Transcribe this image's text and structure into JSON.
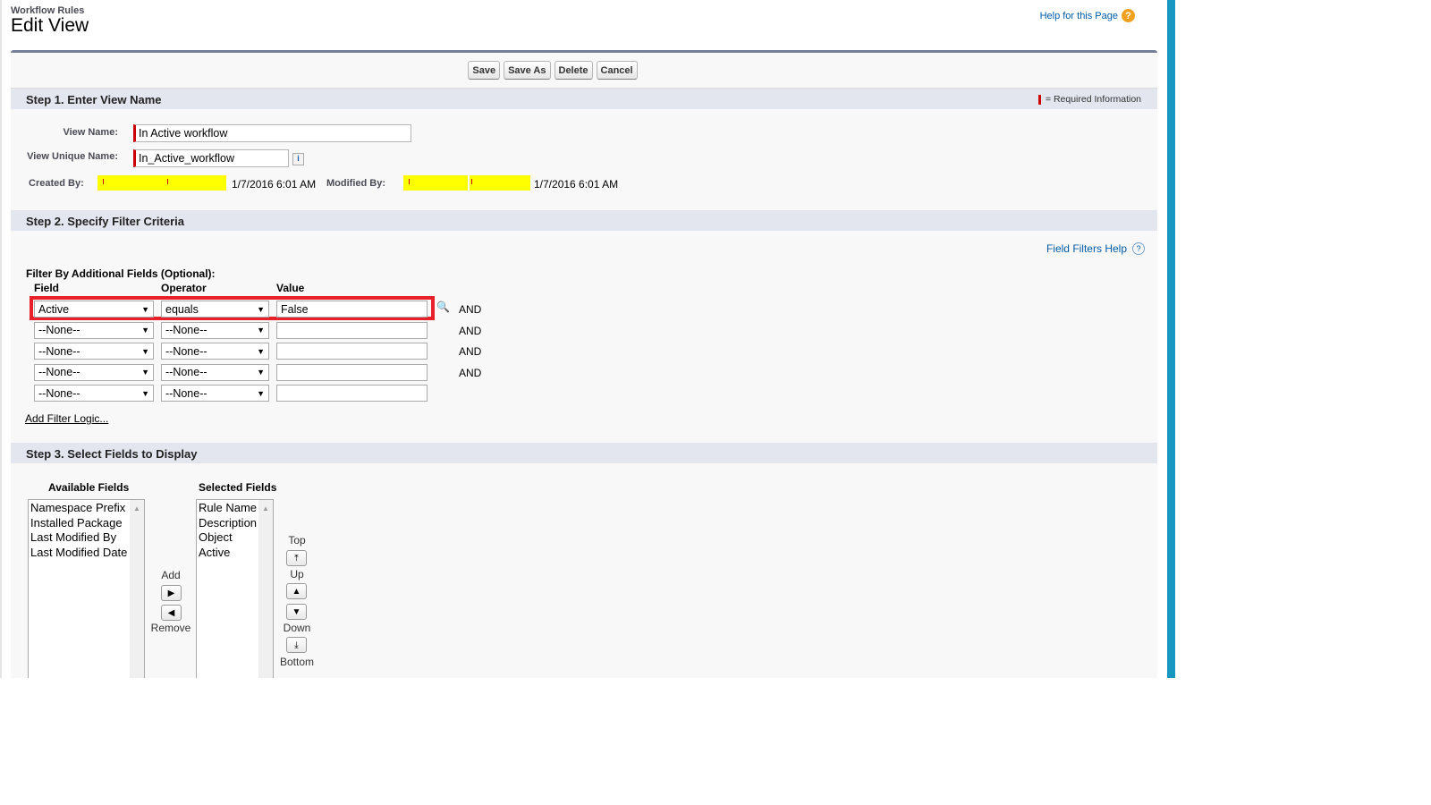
{
  "header": {
    "breadcrumb": "Workflow Rules",
    "title": "Edit View",
    "help_link": "Help for this Page"
  },
  "toolbar": {
    "save": "Save",
    "save_as": "Save As",
    "delete": "Delete",
    "cancel": "Cancel"
  },
  "step1": {
    "title": "Step 1. Enter View Name",
    "required_info": "= Required Information",
    "view_name_label": "View Name:",
    "view_name_value": "In Active workflow",
    "unique_name_label": "View Unique Name:",
    "unique_name_value": "In_Active_workflow",
    "info_icon": "i",
    "created_by_label": "Created By:",
    "created_date": "1/7/2016 6:01 AM",
    "modified_by_label": "Modified By:",
    "modified_date": "1/7/2016 6:01 AM"
  },
  "step2": {
    "title": "Step 2. Specify Filter Criteria",
    "help_link": "Field Filters Help",
    "filter_heading": "Filter By Additional Fields (Optional):",
    "col_field": "Field",
    "col_operator": "Operator",
    "col_value": "Value",
    "rows": [
      {
        "field": "Active",
        "operator": "equals",
        "value": "False",
        "conj": "AND"
      },
      {
        "field": "--None--",
        "operator": "--None--",
        "value": "",
        "conj": "AND"
      },
      {
        "field": "--None--",
        "operator": "--None--",
        "value": "",
        "conj": "AND"
      },
      {
        "field": "--None--",
        "operator": "--None--",
        "value": "",
        "conj": "AND"
      },
      {
        "field": "--None--",
        "operator": "--None--",
        "value": ""
      }
    ],
    "add_logic": "Add Filter Logic..."
  },
  "step3": {
    "title": "Step 3. Select Fields to Display",
    "available_label": "Available Fields",
    "selected_label": "Selected Fields",
    "available": [
      "Namespace Prefix",
      "Installed Package",
      "Last Modified By",
      "Last Modified Date"
    ],
    "selected": [
      "Rule Name",
      "Description",
      "Object",
      "Active"
    ],
    "add": "Add",
    "remove": "Remove",
    "top": "Top",
    "up": "Up",
    "down": "Down",
    "bottom": "Bottom"
  },
  "colors": {
    "accent_bar": "#1797c0",
    "highlight": "#e8202a",
    "required": "#cc0000"
  }
}
